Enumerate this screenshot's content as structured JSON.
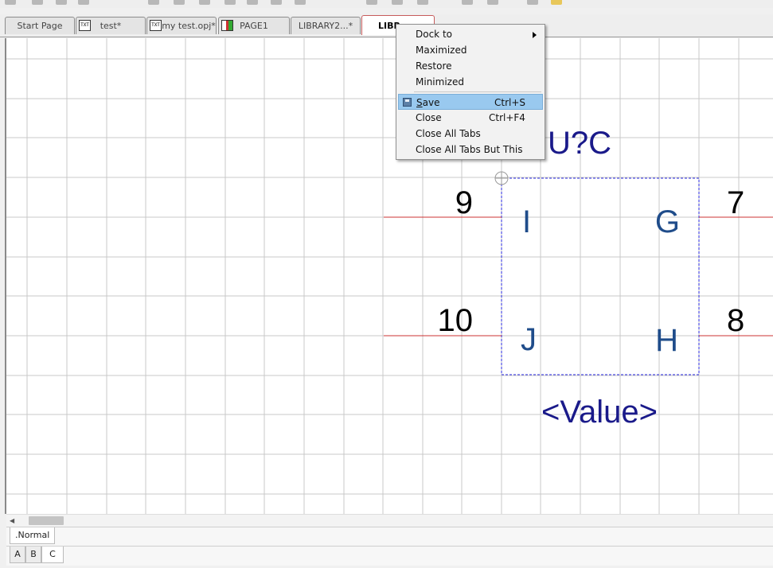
{
  "tabs": [
    {
      "label": "Start Page",
      "icon": "none"
    },
    {
      "label": "test*",
      "icon": "schematic-icon"
    },
    {
      "label": "my test.opj*",
      "icon": "schematic-icon"
    },
    {
      "label": "PAGE1",
      "icon": "page-icon"
    },
    {
      "label": "LIBRARY2...*",
      "icon": "none"
    },
    {
      "label": "LIBR",
      "icon": "none",
      "active": true
    }
  ],
  "tab_icon_text": "TXT",
  "context_menu": {
    "dock_to": "Dock to",
    "maximized": "Maximized",
    "restore": "Restore",
    "minimized": "Minimized",
    "save_first": "S",
    "save_rest": "ave",
    "save_shortcut": "Ctrl+S",
    "close": "Close",
    "close_shortcut": "Ctrl+F4",
    "close_all": "Close All Tabs",
    "close_all_but_this": "Close All Tabs But This"
  },
  "part": {
    "reference": "U?C",
    "value": "<Value>",
    "pins": [
      {
        "number": "9",
        "name": "I"
      },
      {
        "number": "10",
        "name": "J"
      },
      {
        "number": "7",
        "name": "G"
      },
      {
        "number": "8",
        "name": "H"
      }
    ]
  },
  "bottom": {
    "page_tab": ".Normal",
    "sheet_tabs": [
      "A",
      "B",
      "C"
    ]
  },
  "colors": {
    "grid": "#c8c8c8",
    "pin_line": "#cc3333",
    "body_outline": "#2a2ae0",
    "pin_name": "#1f4c8a",
    "reference": "#1a1a8a",
    "menu_highlight": "#99c9ef"
  }
}
